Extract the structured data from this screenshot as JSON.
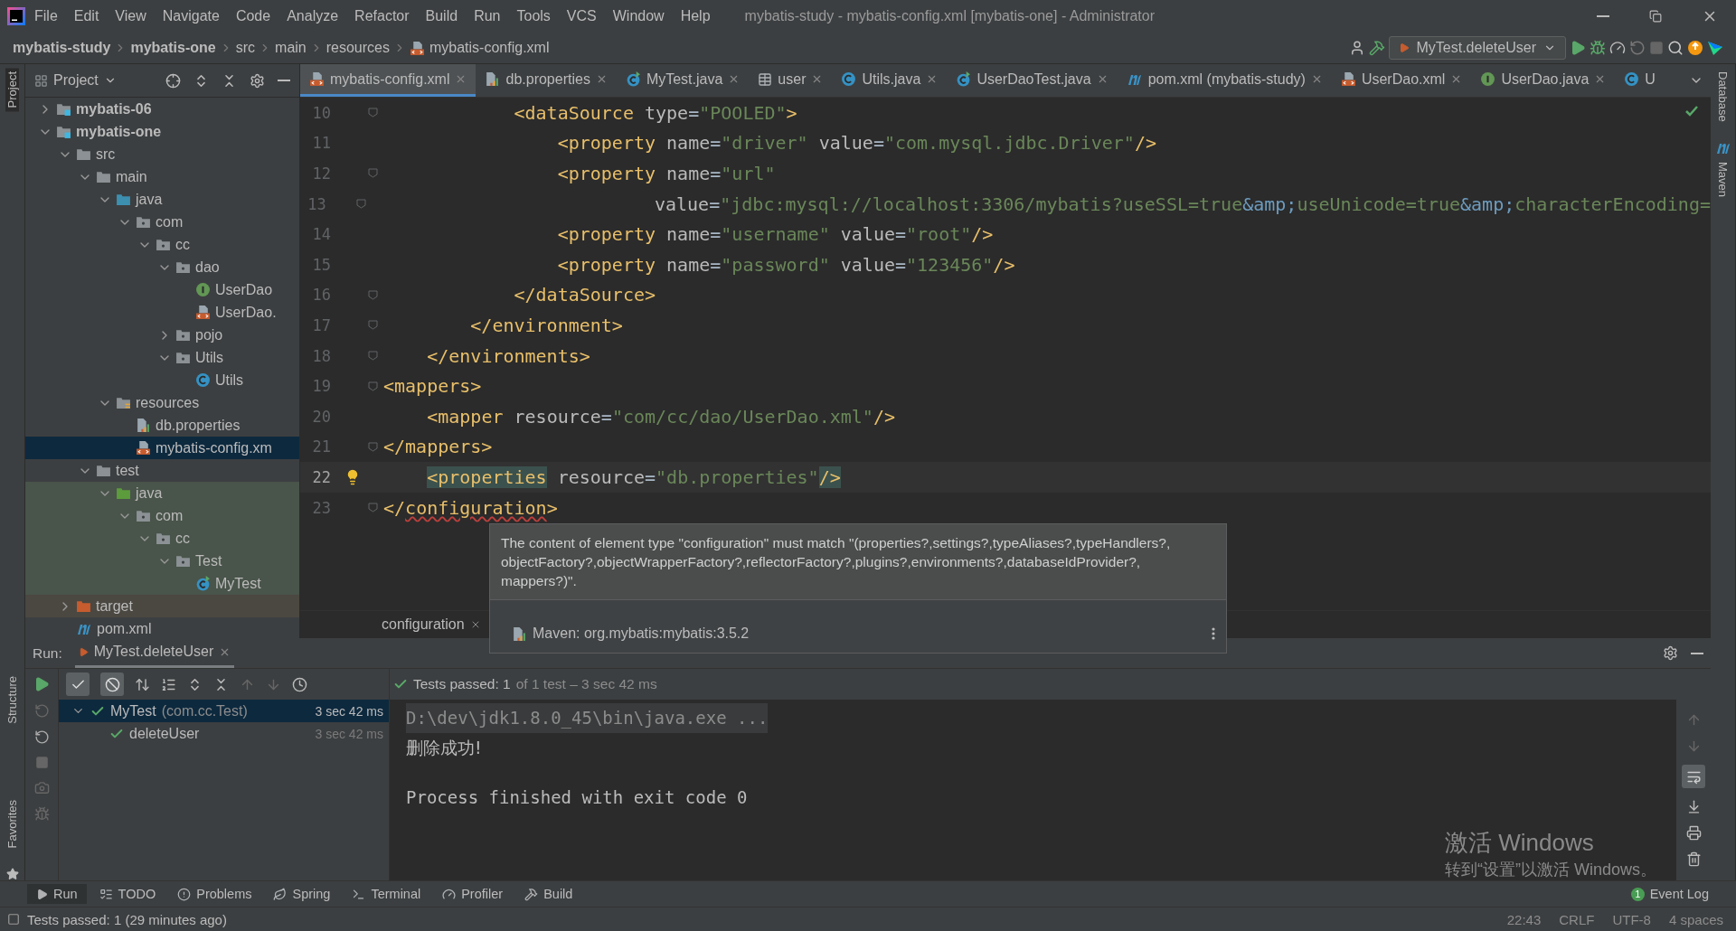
{
  "menu": [
    "File",
    "Edit",
    "View",
    "Navigate",
    "Code",
    "Analyze",
    "Refactor",
    "Build",
    "Run",
    "Tools",
    "VCS",
    "Window",
    "Help"
  ],
  "window_title": "mybatis-study - mybatis-config.xml [mybatis-one] - Administrator",
  "breadcrumbs": [
    {
      "text": "mybatis-study",
      "bold": true
    },
    {
      "text": "mybatis-one",
      "bold": true
    },
    {
      "text": "src",
      "bold": false
    },
    {
      "text": "main",
      "bold": false
    },
    {
      "text": "resources",
      "bold": false
    },
    {
      "text": "mybatis-config.xml",
      "bold": false,
      "kind": "xml"
    }
  ],
  "run_config": "MyTest.deleteUser",
  "left_strip": [
    "Project",
    "Structure",
    "Favorites"
  ],
  "right_strip": [
    "Database",
    "Maven"
  ],
  "project_panel": {
    "title": "Project"
  },
  "tree": [
    {
      "label": "mybatis-06",
      "kind": "module",
      "expanded": false,
      "selected": false
    },
    {
      "label": "mybatis-one",
      "kind": "module",
      "expanded": true,
      "selected": false,
      "children": [
        {
          "label": "src",
          "kind": "folder",
          "expanded": true,
          "selected": false,
          "children": [
            {
              "label": "main",
              "kind": "folder",
              "expanded": true,
              "selected": false,
              "children": [
                {
                  "label": "java",
                  "kind": "source",
                  "expanded": true,
                  "selected": false,
                  "children": [
                    {
                      "label": "com",
                      "kind": "package",
                      "expanded": true,
                      "selected": false,
                      "children": [
                        {
                          "label": "cc",
                          "kind": "package",
                          "expanded": true,
                          "selected": false,
                          "children": [
                            {
                              "label": "dao",
                              "kind": "package",
                              "expanded": true,
                              "selected": false,
                              "children": [
                                {
                                  "label": "UserDao",
                                  "kind": "interface",
                                  "selected": false
                                },
                                {
                                  "label": "UserDao.",
                                  "kind": "xml",
                                  "selected": false
                                }
                              ]
                            },
                            {
                              "label": "pojo",
                              "kind": "package",
                              "expanded": false,
                              "selected": false
                            },
                            {
                              "label": "Utils",
                              "kind": "package",
                              "expanded": true,
                              "selected": false,
                              "children": [
                                {
                                  "label": "Utils",
                                  "kind": "class",
                                  "selected": false
                                }
                              ]
                            }
                          ]
                        }
                      ]
                    }
                  ]
                },
                {
                  "label": "resources",
                  "kind": "resources",
                  "expanded": true,
                  "selected": false,
                  "children": [
                    {
                      "label": "db.properties",
                      "kind": "properties",
                      "selected": false
                    },
                    {
                      "label": "mybatis-config.xm",
                      "kind": "xml",
                      "selected": true
                    }
                  ]
                }
              ]
            },
            {
              "label": "test",
              "kind": "folder",
              "expanded": true,
              "selected": false,
              "children": [
                {
                  "label": "java",
                  "kind": "test",
                  "expanded": true,
                  "selected": false,
                  "children": [
                    {
                      "label": "com",
                      "kind": "package",
                      "expanded": true,
                      "selected": false,
                      "children": [
                        {
                          "label": "cc",
                          "kind": "package",
                          "expanded": true,
                          "selected": false,
                          "children": [
                            {
                              "label": "Test",
                              "kind": "package",
                              "expanded": true,
                              "selected": false,
                              "children": [
                                {
                                  "label": "MyTest",
                                  "kind": "testclass",
                                  "selected": false
                                }
                              ]
                            }
                          ]
                        }
                      ]
                    }
                  ]
                }
              ]
            }
          ]
        },
        {
          "label": "target",
          "kind": "excluded",
          "expanded": false,
          "selected": false
        },
        {
          "label": "pom.xml",
          "kind": "maven",
          "selected": false
        }
      ]
    }
  ],
  "tabs": [
    {
      "label": "mybatis-config.xml",
      "kind": "xml",
      "selected": true
    },
    {
      "label": "db.properties",
      "kind": "properties",
      "selected": false
    },
    {
      "label": "MyTest.java",
      "kind": "testclass",
      "selected": false
    },
    {
      "label": "user",
      "kind": "table",
      "selected": false
    },
    {
      "label": "Utils.java",
      "kind": "class",
      "selected": false
    },
    {
      "label": "UserDaoTest.java",
      "kind": "testclass",
      "selected": false
    },
    {
      "label": "pom.xml (mybatis-study)",
      "kind": "maven",
      "selected": false
    },
    {
      "label": "UserDao.xml",
      "kind": "xml",
      "selected": false
    },
    {
      "label": "UserDao.java",
      "kind": "interface",
      "selected": false
    },
    {
      "label": "U",
      "kind": "class",
      "selected": false
    }
  ],
  "code": [
    {
      "number": "10",
      "fold": true,
      "current": false,
      "tokens": [
        {
          "kind": "tag",
          "text": "            <dataSource"
        },
        {
          "kind": "attr",
          "text": " type"
        },
        {
          "kind": "text",
          "text": "="
        },
        {
          "kind": "value",
          "text": "\"POOLED\""
        },
        {
          "kind": "tag",
          "text": ">"
        }
      ]
    },
    {
      "number": "11",
      "fold": false,
      "current": false,
      "tokens": [
        {
          "kind": "tag",
          "text": "                <property"
        },
        {
          "kind": "attr",
          "text": " name"
        },
        {
          "kind": "text",
          "text": "="
        },
        {
          "kind": "value",
          "text": "\"driver\""
        },
        {
          "kind": "attr",
          "text": " value"
        },
        {
          "kind": "text",
          "text": "="
        },
        {
          "kind": "value",
          "text": "\"com.mysql.jdbc.Driver\""
        },
        {
          "kind": "tag",
          "text": "/>"
        }
      ]
    },
    {
      "number": "12",
      "fold": true,
      "current": false,
      "tokens": [
        {
          "kind": "tag",
          "text": "                <property"
        },
        {
          "kind": "attr",
          "text": " name"
        },
        {
          "kind": "text",
          "text": "="
        },
        {
          "kind": "value",
          "text": "\"url\""
        }
      ]
    },
    {
      "number": "13",
      "fold": true,
      "current": false,
      "tokens": [
        {
          "kind": "attr",
          "text": "                          value"
        },
        {
          "kind": "text",
          "text": "="
        },
        {
          "kind": "value",
          "text": "\"jdbc:mysql://localhost:3306/mybatis?useSSL=true"
        },
        {
          "kind": "entity",
          "text": "&amp;"
        },
        {
          "kind": "value",
          "text": "useUnicode=true"
        },
        {
          "kind": "entity",
          "text": "&amp;"
        },
        {
          "kind": "value",
          "text": "characterEncoding="
        }
      ]
    },
    {
      "number": "14",
      "fold": false,
      "current": false,
      "tokens": [
        {
          "kind": "tag",
          "text": "                <property"
        },
        {
          "kind": "attr",
          "text": " name"
        },
        {
          "kind": "text",
          "text": "="
        },
        {
          "kind": "value",
          "text": "\"username\""
        },
        {
          "kind": "attr",
          "text": " value"
        },
        {
          "kind": "text",
          "text": "="
        },
        {
          "kind": "value",
          "text": "\"root\""
        },
        {
          "kind": "tag",
          "text": "/>"
        }
      ]
    },
    {
      "number": "15",
      "fold": false,
      "current": false,
      "tokens": [
        {
          "kind": "tag",
          "text": "                <property"
        },
        {
          "kind": "attr",
          "text": " name"
        },
        {
          "kind": "text",
          "text": "="
        },
        {
          "kind": "value",
          "text": "\"password\""
        },
        {
          "kind": "attr",
          "text": " value"
        },
        {
          "kind": "text",
          "text": "="
        },
        {
          "kind": "value",
          "text": "\"123456\""
        },
        {
          "kind": "tag",
          "text": "/>"
        }
      ]
    },
    {
      "number": "16",
      "fold": true,
      "current": false,
      "tokens": [
        {
          "kind": "tag",
          "text": "            </dataSource>"
        }
      ]
    },
    {
      "number": "17",
      "fold": true,
      "current": false,
      "tokens": [
        {
          "kind": "tag",
          "text": "        </environment>"
        }
      ]
    },
    {
      "number": "18",
      "fold": true,
      "current": false,
      "tokens": [
        {
          "kind": "tag",
          "text": "    </environments>"
        }
      ]
    },
    {
      "number": "19",
      "fold": true,
      "current": false,
      "tokens": [
        {
          "kind": "tag",
          "text": "<mappers>"
        }
      ]
    },
    {
      "number": "20",
      "fold": false,
      "current": false,
      "tokens": [
        {
          "kind": "tag",
          "text": "    <mapper"
        },
        {
          "kind": "attr",
          "text": " resource"
        },
        {
          "kind": "text",
          "text": "="
        },
        {
          "kind": "value",
          "text": "\"com/cc/dao/UserDao.xml\""
        },
        {
          "kind": "tag",
          "text": "/>"
        }
      ]
    },
    {
      "number": "21",
      "fold": true,
      "current": false,
      "tokens": [
        {
          "kind": "tag",
          "text": "</mappers>"
        }
      ]
    },
    {
      "number": "22",
      "fold": false,
      "current": true,
      "bulb": true,
      "tokens": [
        {
          "kind": "tag",
          "text": "    <properties",
          "matched": true
        },
        {
          "kind": "attr",
          "text": " resource"
        },
        {
          "kind": "text",
          "text": "="
        },
        {
          "kind": "value",
          "text": "\"db.properties\""
        },
        {
          "kind": "tag",
          "text": "/>",
          "matched": true
        }
      ]
    },
    {
      "number": "23",
      "fold": true,
      "current": false,
      "tokens": [
        {
          "kind": "tag",
          "text": "</"
        },
        {
          "kind": "tag",
          "text": "configuration",
          "error": true
        },
        {
          "kind": "tag",
          "text": ">"
        }
      ]
    }
  ],
  "editor_breadcrumb": "configuration",
  "tooltip": {
    "message": "The content of element type \"configuration\" must match \"(properties?,settings?,typeAliases?,typeHandlers?,objectFactory?,objectWrapperFactory?,reflectorFactory?,plugins?,environments?,databaseIdProvider?,mappers?)\".",
    "source": "Maven: org.mybatis:mybatis:3.5.2"
  },
  "run": {
    "label": "Run:",
    "tab": "MyTest.deleteUser",
    "status": "Tests passed: 1",
    "status_detail": "of 1 test – 3 sec 42 ms",
    "tests": [
      {
        "name": "MyTest",
        "detail": "(com.cc.Test)",
        "time": "3 sec 42 ms",
        "selected": true,
        "children": [
          {
            "name": "deleteUser",
            "time": "3 sec 42 ms",
            "selected": false
          }
        ]
      }
    ],
    "console": [
      {
        "kind": "command",
        "text": "D:\\dev\\jdk1.8.0_45\\bin\\java.exe ..."
      },
      {
        "kind": "output",
        "text": "删除成功!"
      },
      {
        "kind": "exit",
        "text": "Process finished with exit code 0"
      }
    ]
  },
  "activation": {
    "title": "激活 Windows",
    "subtitle": "转到“设置”以激活 Windows。"
  },
  "tool_tabs": [
    {
      "label": "Run",
      "kind": "run",
      "selected": true
    },
    {
      "label": "TODO",
      "kind": "todo",
      "selected": false
    },
    {
      "label": "Problems",
      "kind": "problems",
      "selected": false
    },
    {
      "label": "Spring",
      "kind": "spring",
      "selected": false
    },
    {
      "label": "Terminal",
      "kind": "terminal",
      "selected": false
    },
    {
      "label": "Profiler",
      "kind": "profiler",
      "selected": false
    },
    {
      "label": "Build",
      "kind": "build",
      "selected": false
    }
  ],
  "event_log": {
    "label": "Event Log",
    "count": "1"
  },
  "status_bar": {
    "message": "Tests passed: 1 (29 minutes ago)",
    "items": [
      "22:43",
      "CRLF",
      "UTF-8",
      "4 spaces"
    ]
  }
}
